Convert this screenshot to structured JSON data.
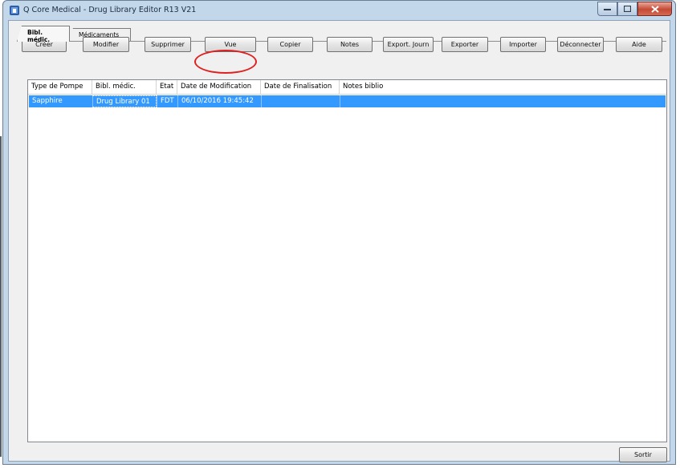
{
  "window": {
    "title": "Q Core Medical - Drug Library Editor R13 V21"
  },
  "tabs": [
    {
      "label": "Bibl. médic.",
      "active": true
    },
    {
      "label": "Médicaments",
      "active": false
    }
  ],
  "toolbar": {
    "buttons": [
      "Créer",
      "Modifier",
      "Supprimer",
      "Vue",
      "Copier",
      "Notes",
      "Export. Journ",
      "Exporter",
      "Importer",
      "Déconnecter",
      "Aide"
    ],
    "highlighted": "Vue"
  },
  "table": {
    "columns": [
      "Type de Pompe",
      "Bibl. médic.",
      "Etat",
      "Date de Modification",
      "Date de Finalisation",
      "Notes biblio"
    ],
    "rows": [
      [
        "Sapphire",
        "Drug Library 01",
        "FDT",
        "06/10/2016 19:45:42",
        "",
        ""
      ]
    ],
    "selected_row": 0
  },
  "footer": {
    "exit_label": "Sortir"
  },
  "colors": {
    "selection": "#3399ff",
    "highlight_ring": "#e02020",
    "window_frame": "#c3d7ea"
  }
}
